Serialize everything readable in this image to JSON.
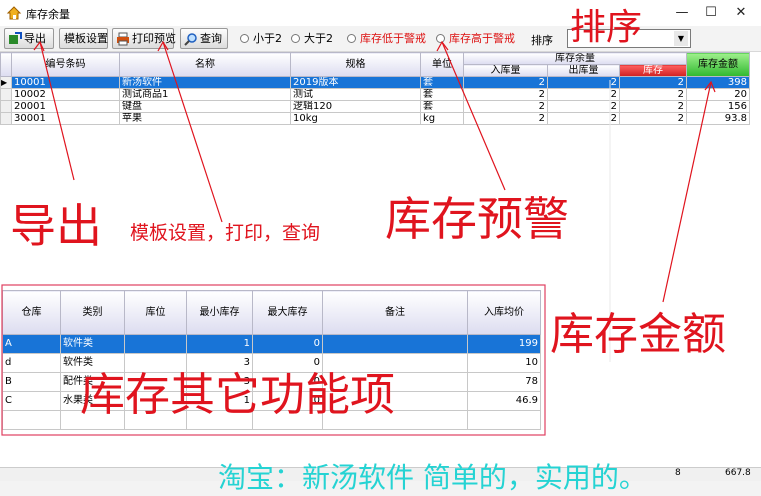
{
  "window": {
    "title": "库存余量",
    "minimize": "—",
    "maximize": "☐",
    "close": "✕"
  },
  "toolbar": {
    "export": "导出",
    "template": "模板设置",
    "print_preview": "打印预览",
    "query": "查询",
    "radios": [
      "小于2",
      "大于2",
      "库存低于警戒",
      "库存高于警戒"
    ],
    "sort_label": "排序",
    "sort_value": ""
  },
  "grid1": {
    "group_header": "库存余量",
    "headers": [
      "编号条码",
      "名称",
      "规格",
      "单位",
      "入库量",
      "出库量",
      "库存",
      "库存金额"
    ],
    "rows": [
      [
        "10001",
        "新汤软件",
        "2019版本",
        "套",
        "2",
        "2",
        "2",
        "398"
      ],
      [
        "10002",
        "测试商品1",
        "测试",
        "套",
        "2",
        "2",
        "2",
        "20"
      ],
      [
        "20001",
        "键盘",
        "逻辑120",
        "套",
        "2",
        "2",
        "2",
        "156"
      ],
      [
        "30001",
        "苹果",
        "10kg",
        "kg",
        "2",
        "2",
        "2",
        "93.8"
      ]
    ]
  },
  "grid2": {
    "headers": [
      "仓库",
      "类别",
      "库位",
      "最小库存",
      "最大库存",
      "备注",
      "入库均价"
    ],
    "rows": [
      [
        "A",
        "软件类",
        "",
        "1",
        "0",
        "",
        "199"
      ],
      [
        "d",
        "软件类",
        "",
        "3",
        "0",
        "",
        "10"
      ],
      [
        "B",
        "配件类",
        "",
        "3",
        "0",
        "",
        "78"
      ],
      [
        "C",
        "水果类",
        "",
        "1",
        "0",
        "",
        "46.9"
      ]
    ]
  },
  "footer": {
    "total_qty": "8",
    "total_amount": "667.8"
  },
  "annotations": {
    "sort": "排序",
    "export": "导出",
    "template_print_query": "模板设置，打印，查询",
    "stock_warning": "库存预警",
    "stock_amount": "库存金额",
    "other_functions": "库存其它功能项",
    "taobao": "淘宝：新汤软件 简单的，实用的。"
  },
  "colors": {
    "selection": "#1874d7",
    "red_header": "#e02828",
    "green_header": "#3cc83c",
    "annotation_red": "#e0141e",
    "annotation_cyan": "#25d3d3"
  }
}
